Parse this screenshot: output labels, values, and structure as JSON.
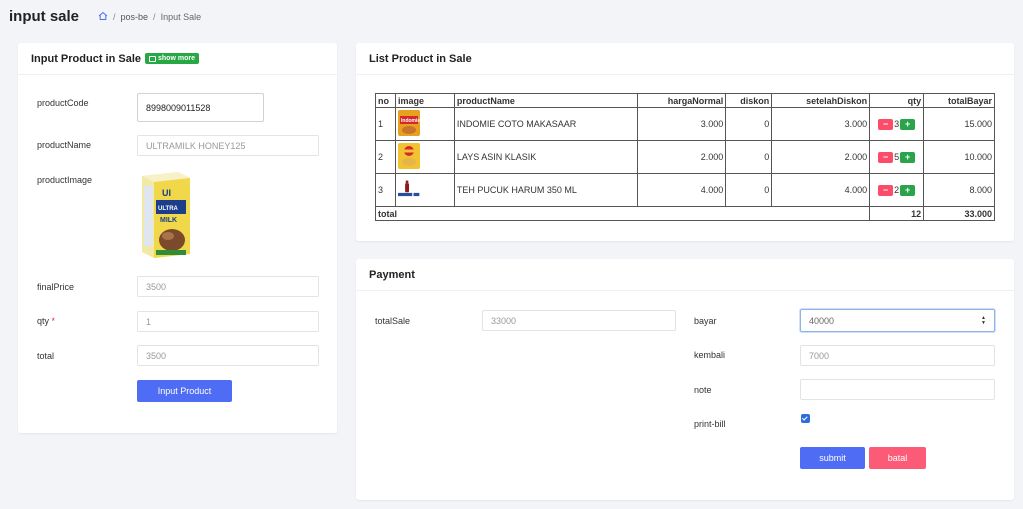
{
  "page": {
    "title": "input sale",
    "breadcrumb": {
      "home_icon": "home-icon",
      "separator": "/",
      "items": [
        "pos-be",
        "Input Sale"
      ]
    }
  },
  "input_card": {
    "title": "Input Product in Sale",
    "show_more_label": "show more",
    "fields": {
      "productCode": {
        "label": "productCode",
        "value": "8998009011528"
      },
      "productName": {
        "label": "productName",
        "value": "ULTRAMILK HONEY125"
      },
      "productImage": {
        "label": "productImage",
        "image_icon": "ultramilk-carton-image"
      },
      "finalPrice": {
        "label": "finalPrice",
        "value": "3500"
      },
      "qty": {
        "label": "qty",
        "required_mark": "*",
        "value": "1"
      },
      "total": {
        "label": "total",
        "value": "3500"
      }
    },
    "submit_label": "Input Product"
  },
  "list_card": {
    "title": "List Product in Sale",
    "columns": [
      "no",
      "image",
      "productName",
      "hargaNormal",
      "diskon",
      "setelahDiskon",
      "qty",
      "totalBayar"
    ],
    "rows": [
      {
        "no": "1",
        "image_icon": "indomie-package-image",
        "productName": "INDOMIE COTO MAKASAAR",
        "hargaNormal": "3.000",
        "diskon": "0",
        "setelahDiskon": "3.000",
        "qty": "3",
        "totalBayar": "15.000",
        "color": "#e8a020"
      },
      {
        "no": "2",
        "image_icon": "lays-package-image",
        "productName": "LAYS ASIN KLASIK",
        "hargaNormal": "2.000",
        "diskon": "0",
        "setelahDiskon": "2.000",
        "qty": "5",
        "totalBayar": "10.000",
        "color": "#f1c232"
      },
      {
        "no": "3",
        "image_icon": "teh-pucuk-bottle-image",
        "productName": "TEH PUCUK HARUM 350 ML",
        "hargaNormal": "4.000",
        "diskon": "0",
        "setelahDiskon": "4.000",
        "qty": "2",
        "totalBayar": "8.000",
        "color": "#8b1a1a"
      }
    ],
    "total_row": {
      "label": "total",
      "qty": "12",
      "totalBayar": "33.000"
    },
    "minus_symbol": "−",
    "plus_symbol": "+"
  },
  "payment_card": {
    "title": "Payment",
    "totalSale": {
      "label": "totalSale",
      "value": "33000"
    },
    "bayar": {
      "label": "bayar",
      "value": "40000"
    },
    "kembali": {
      "label": "kembali",
      "value": "7000"
    },
    "note": {
      "label": "note",
      "value": ""
    },
    "print_bill": {
      "label": "print-bill",
      "checked": true
    },
    "submit_label": "submit",
    "cancel_label": "batal"
  },
  "colors": {
    "primary": "#4f6cf5",
    "danger": "#fc5b77",
    "success": "#28a745"
  }
}
